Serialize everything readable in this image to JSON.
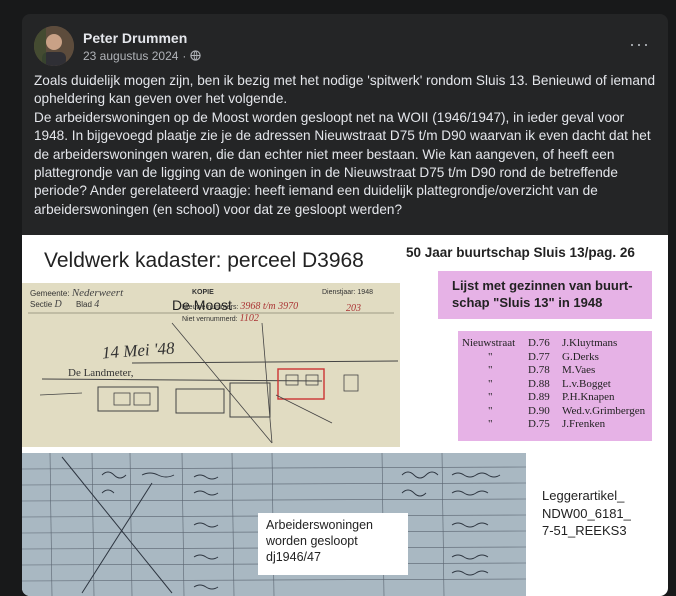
{
  "post": {
    "author": "Peter Drummen",
    "date": "23 augustus 2024",
    "more_label": "···",
    "paragraphs": [
      "Zoals duidelijk mogen zijn, ben ik bezig met het nodige 'spitwerk' rondom Sluis 13. Benieuwd of iemand opheldering kan geven over het volgende.",
      "De arbeiderswoningen op de Moost worden gesloopt net na WOII (1946/1947), in ieder geval voor 1948. In bijgevoegd plaatje zie je de adressen Nieuwstraat D75 t/m D90 waarvan ik even dacht dat het de arbeiderswoningen waren, die dan echter niet meer bestaan. Wie kan aangeven, of heeft een plattegrondje van de ligging van de woningen in de Nieuwstraat D75 t/m D90 rond de betreffende periode? Ander gerelateerd vraagje: heeft iemand een duidelijk plattegrondje/overzicht van de arbeiderswoningen (en school) voor dat ze gesloopt werden?"
    ]
  },
  "image": {
    "kadaster_title": "Veldwerk kadaster: perceel D3968",
    "book_title": "50 Jaar buurtschap Sluis 13/pag. 26",
    "list_heading": "Lijst met gezinnen van buurt-schap \"Sluis 13\" in 1948",
    "kadaster_label": "De Moost",
    "kadaster_handwriting": "14 Mei '48",
    "kadaster_signature": "De Landmeter,",
    "kadaster_form": {
      "gemeente_label": "Gemeente:",
      "gemeente_value": "Nederweert",
      "sectie_label": "Sectie",
      "sectie_value": "D",
      "blad_label": "Blad",
      "blad_value": "4",
      "kopie": "KOPIE",
      "nieuwe_nummers": "Nieuwe nummers:",
      "nieuwe_value": "3968 t/m 3970",
      "niet_vernummerd": "Niet vernummerd:",
      "niet_value": "1102",
      "dienstjaar": "Dienstjaar: 1948",
      "extra": "203"
    },
    "residents": [
      {
        "street": "Nieuwstraat",
        "code": "D.76",
        "name": "J.Kluytmans"
      },
      {
        "street": "\"",
        "code": "D.77",
        "name": "G.Derks"
      },
      {
        "street": "\"",
        "code": "D.78",
        "name": "M.Vaes"
      },
      {
        "street": "\"",
        "code": "D.88",
        "name": "L.v.Bogget"
      },
      {
        "street": "\"",
        "code": "D.89",
        "name": "P.H.Knapen"
      },
      {
        "street": "\"",
        "code": "D.90",
        "name": "Wed.v.Grimbergen"
      },
      {
        "street": "\"",
        "code": "D.75",
        "name": "J.Frenken"
      }
    ],
    "ledger_note": [
      "Arbeiderswoningen",
      "worden gesloopt",
      "dj1946/47"
    ],
    "legger": [
      "Leggerartikel_",
      "NDW00_6181_",
      "7-51_REEKS3"
    ]
  },
  "colors": {
    "card": "#242526",
    "pink": "#e6b2e6"
  }
}
